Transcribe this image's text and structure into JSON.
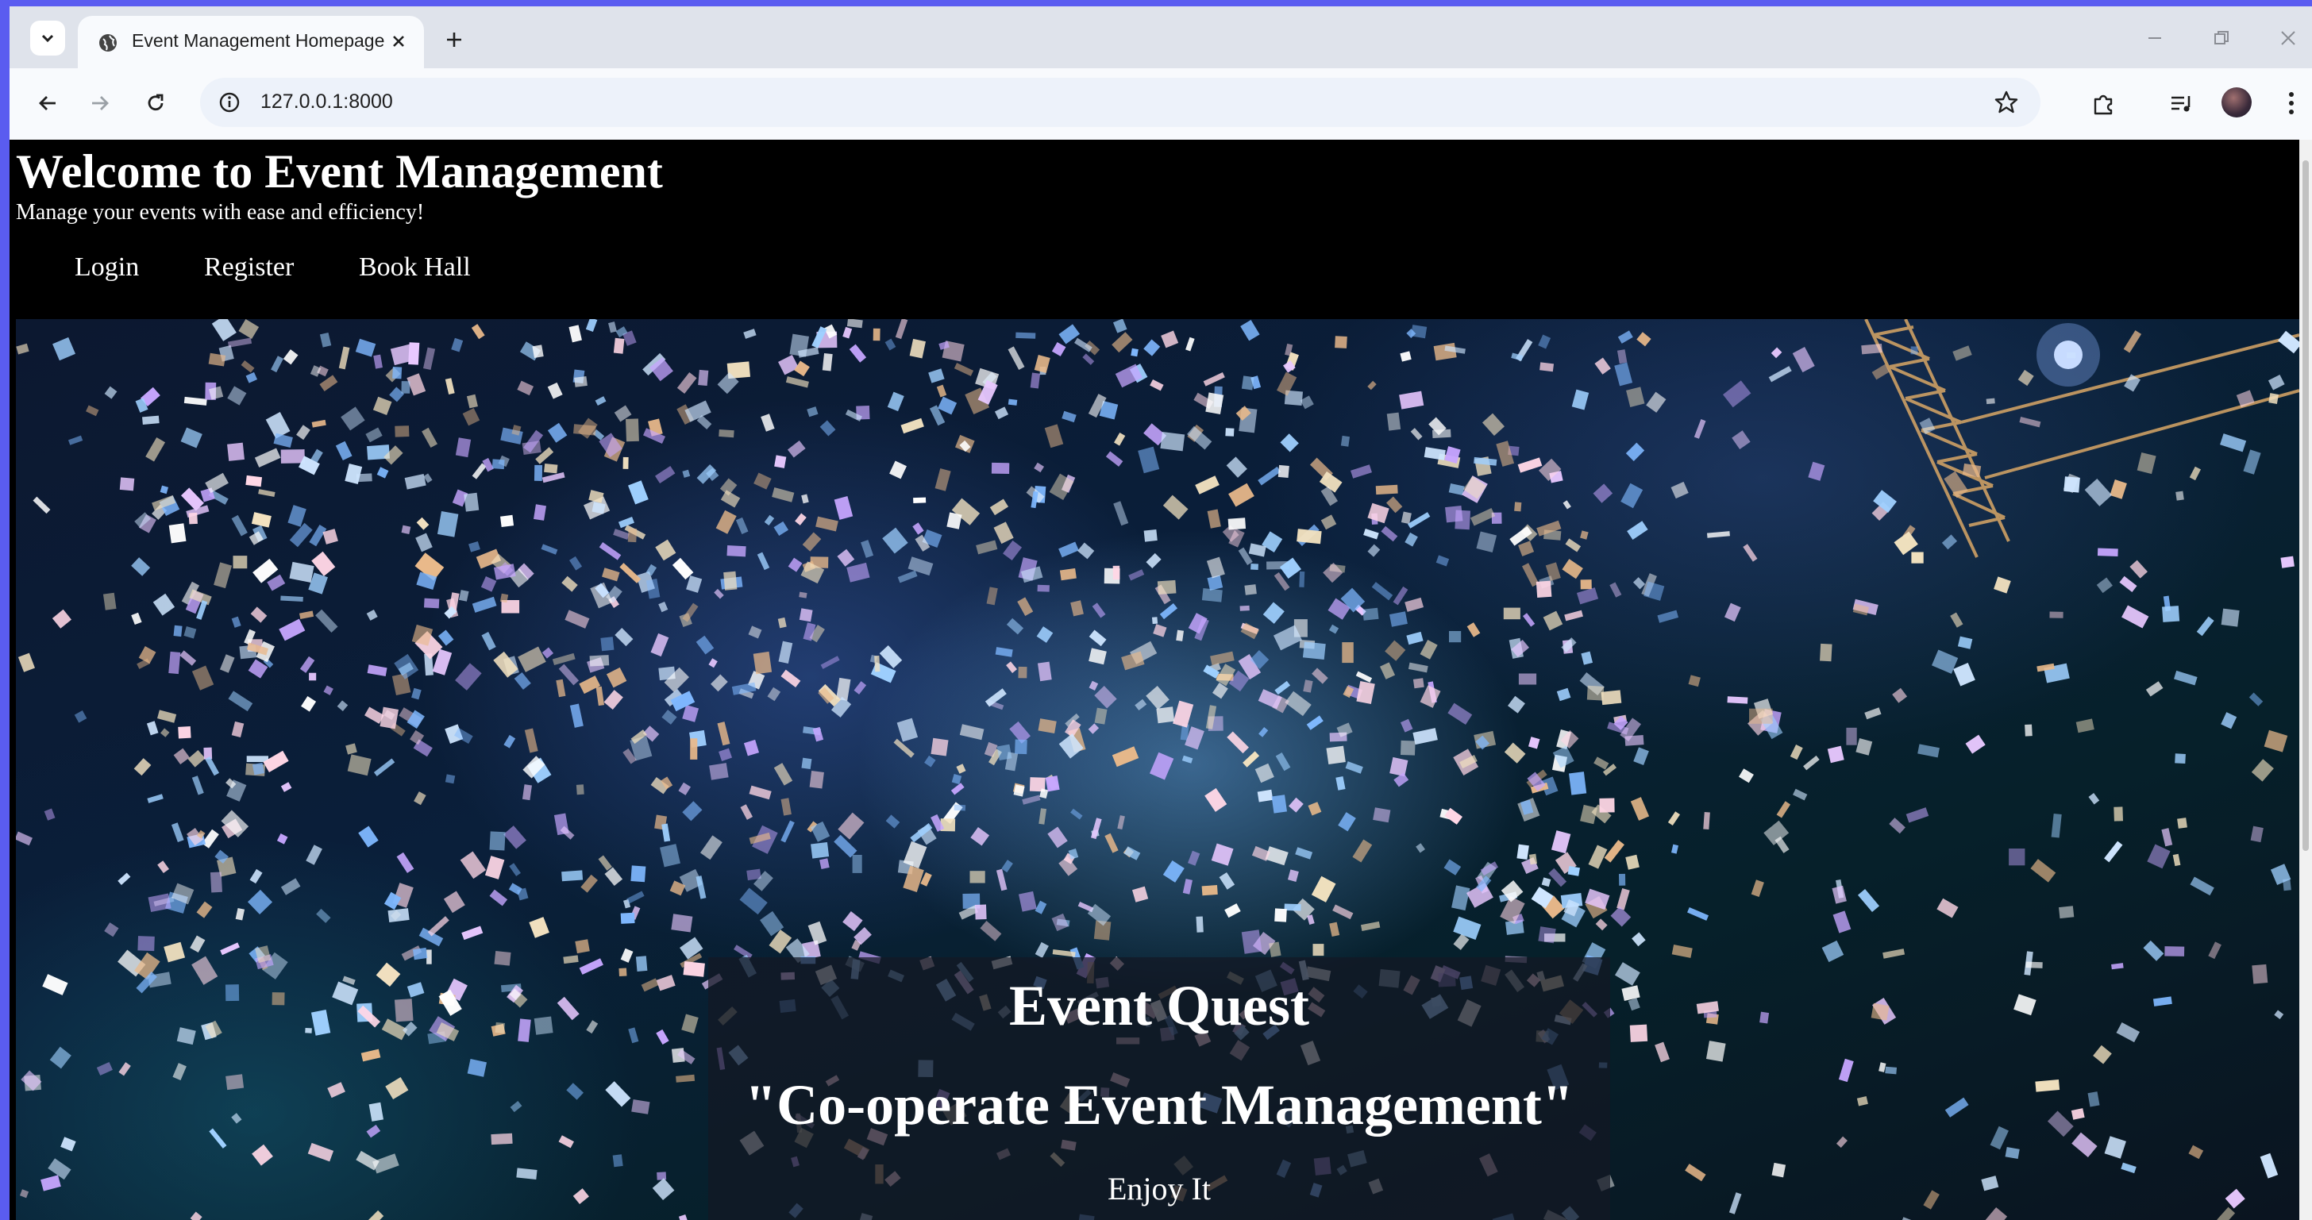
{
  "browser": {
    "tab": {
      "title": "Event Management Homepage"
    },
    "address_bar": {
      "url": "127.0.0.1:8000"
    }
  },
  "page": {
    "header": {
      "title": "Welcome to Event Management",
      "tagline": "Manage your events with ease and efficiency!"
    },
    "nav": [
      {
        "label": "Login"
      },
      {
        "label": "Register"
      },
      {
        "label": "Book Hall"
      }
    ],
    "hero": {
      "title": "Event Quest",
      "subtitle": "\"Co-operate Event Management\"",
      "tagline": "Enjoy It"
    }
  },
  "icons": {
    "tab_search": "chevron-down-icon",
    "favicon": "globe-icon",
    "tab_close": "close-icon",
    "new_tab": "plus-icon",
    "back": "arrow-left-icon",
    "forward": "arrow-right-icon",
    "reload": "reload-icon",
    "site_info": "info-icon",
    "bookmark": "star-icon",
    "extensions": "puzzle-icon",
    "media": "media-control-icon",
    "profile": "avatar",
    "menu": "kebab-menu-icon"
  },
  "colors": {
    "desktop_bg": "#5a5cf0",
    "browser_chrome": "#dfe3eb",
    "page_header_bg": "#000000",
    "page_text": "#ffffff"
  }
}
